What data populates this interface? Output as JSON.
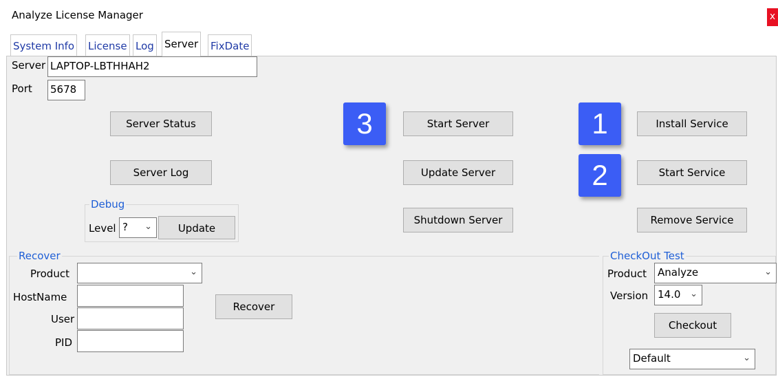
{
  "window": {
    "title": "Analyze License Manager",
    "close_glyph": "x"
  },
  "tabs": [
    {
      "label": "System Info"
    },
    {
      "label": "License"
    },
    {
      "label": "Log"
    },
    {
      "label": "Server",
      "active": true
    },
    {
      "label": "FixDate"
    }
  ],
  "server": {
    "server_label": "Server",
    "server_value": "LAPTOP-LBTHHAH2",
    "port_label": "Port",
    "port_value": "5678"
  },
  "buttons": {
    "server_status": "Server Status",
    "server_log": "Server Log",
    "start_server": "Start Server",
    "update_server": "Update Server",
    "shutdown_server": "Shutdown Server",
    "install_service": "Install Service",
    "start_service": "Start Service",
    "remove_service": "Remove Service"
  },
  "debug": {
    "group_label": "Debug",
    "level_label": "Level",
    "level_value": "?",
    "update_button": "Update"
  },
  "badges": {
    "b1": "1",
    "b2": "2",
    "b3": "3"
  },
  "recover": {
    "group_label": "Recover",
    "product_label": "Product",
    "product_value": "",
    "hostname_label": "HostName",
    "hostname_value": "",
    "user_label": "User",
    "user_value": "",
    "pid_label": "PID",
    "pid_value": "",
    "recover_button": "Recover"
  },
  "checkout": {
    "group_label": "CheckOut Test",
    "product_label": "Product",
    "product_value": "Analyze",
    "version_label": "Version",
    "version_value": "14.0",
    "checkout_button": "Checkout",
    "mode_value": "Default"
  },
  "colors": {
    "badge": "#3b5df5",
    "group_label": "#1f5fd6",
    "tab_text": "#1f3aa6",
    "panel_bg": "#f0f0f0"
  }
}
